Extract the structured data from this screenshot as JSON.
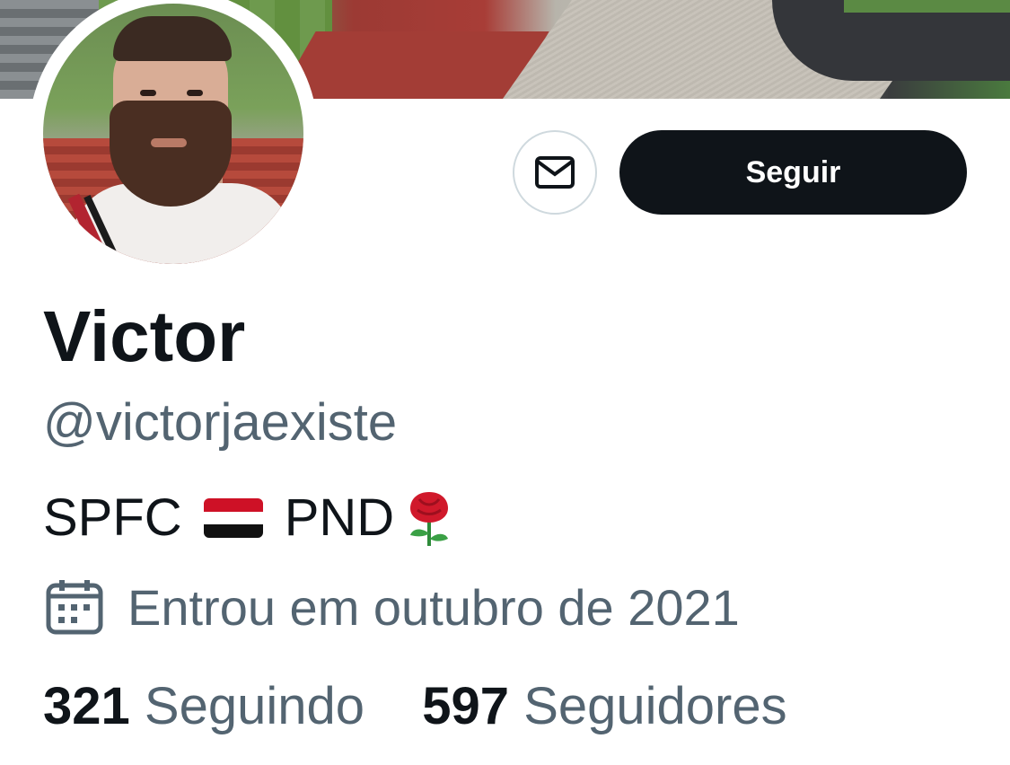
{
  "profile": {
    "name": "Victor",
    "handle": "@victorjaexiste",
    "bio": {
      "text_before_flag": "SPFC",
      "text_after_flag": "PND"
    },
    "joined": "Entrou em outubro de 2021",
    "following_count": "321",
    "following_label": "Seguindo",
    "followers_count": "597",
    "followers_label": "Seguidores"
  },
  "actions": {
    "follow_label": "Seguir"
  },
  "colors": {
    "primary_text": "#0f1419",
    "secondary_text": "#536471",
    "button_bg": "#0f1419",
    "border": "#cfd9de"
  },
  "icons": {
    "message": "envelope-icon",
    "calendar": "calendar-icon",
    "flag": "flag-red-white-black",
    "rose": "rose-emoji"
  }
}
